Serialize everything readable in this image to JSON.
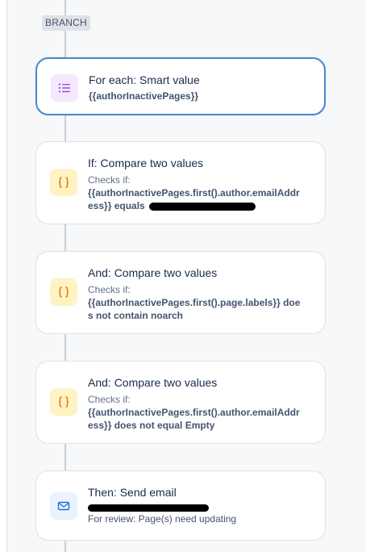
{
  "branch": {
    "label": "BRANCH"
  },
  "cards": [
    {
      "title": "For each: Smart value",
      "detail": "{{authorInactivePages}}",
      "icon": "list-icon"
    },
    {
      "title": "If: Compare two values",
      "checks_label": "Checks if:",
      "detail": "{{authorInactivePages.first().author.emailAddress}} equals",
      "icon": "braces-icon"
    },
    {
      "title": "And: Compare two values",
      "checks_label": "Checks if:",
      "detail": "{{authorInactivePages.first().page.labels}} does not contain noarch",
      "icon": "braces-icon"
    },
    {
      "title": "And: Compare two values",
      "checks_label": "Checks if:",
      "detail": "{{authorInactivePages.first().author.emailAddress}} does not equal Empty",
      "icon": "braces-icon"
    },
    {
      "title": "Then: Send email",
      "subtitle": "For review: Page(s) need updating",
      "icon": "mail-icon"
    }
  ],
  "colors": {
    "accent": "#4c86cf",
    "purple_tile": "#f3e8ff",
    "yellow_tile": "#fff3c4",
    "blue_tile": "#e9f2ff"
  }
}
